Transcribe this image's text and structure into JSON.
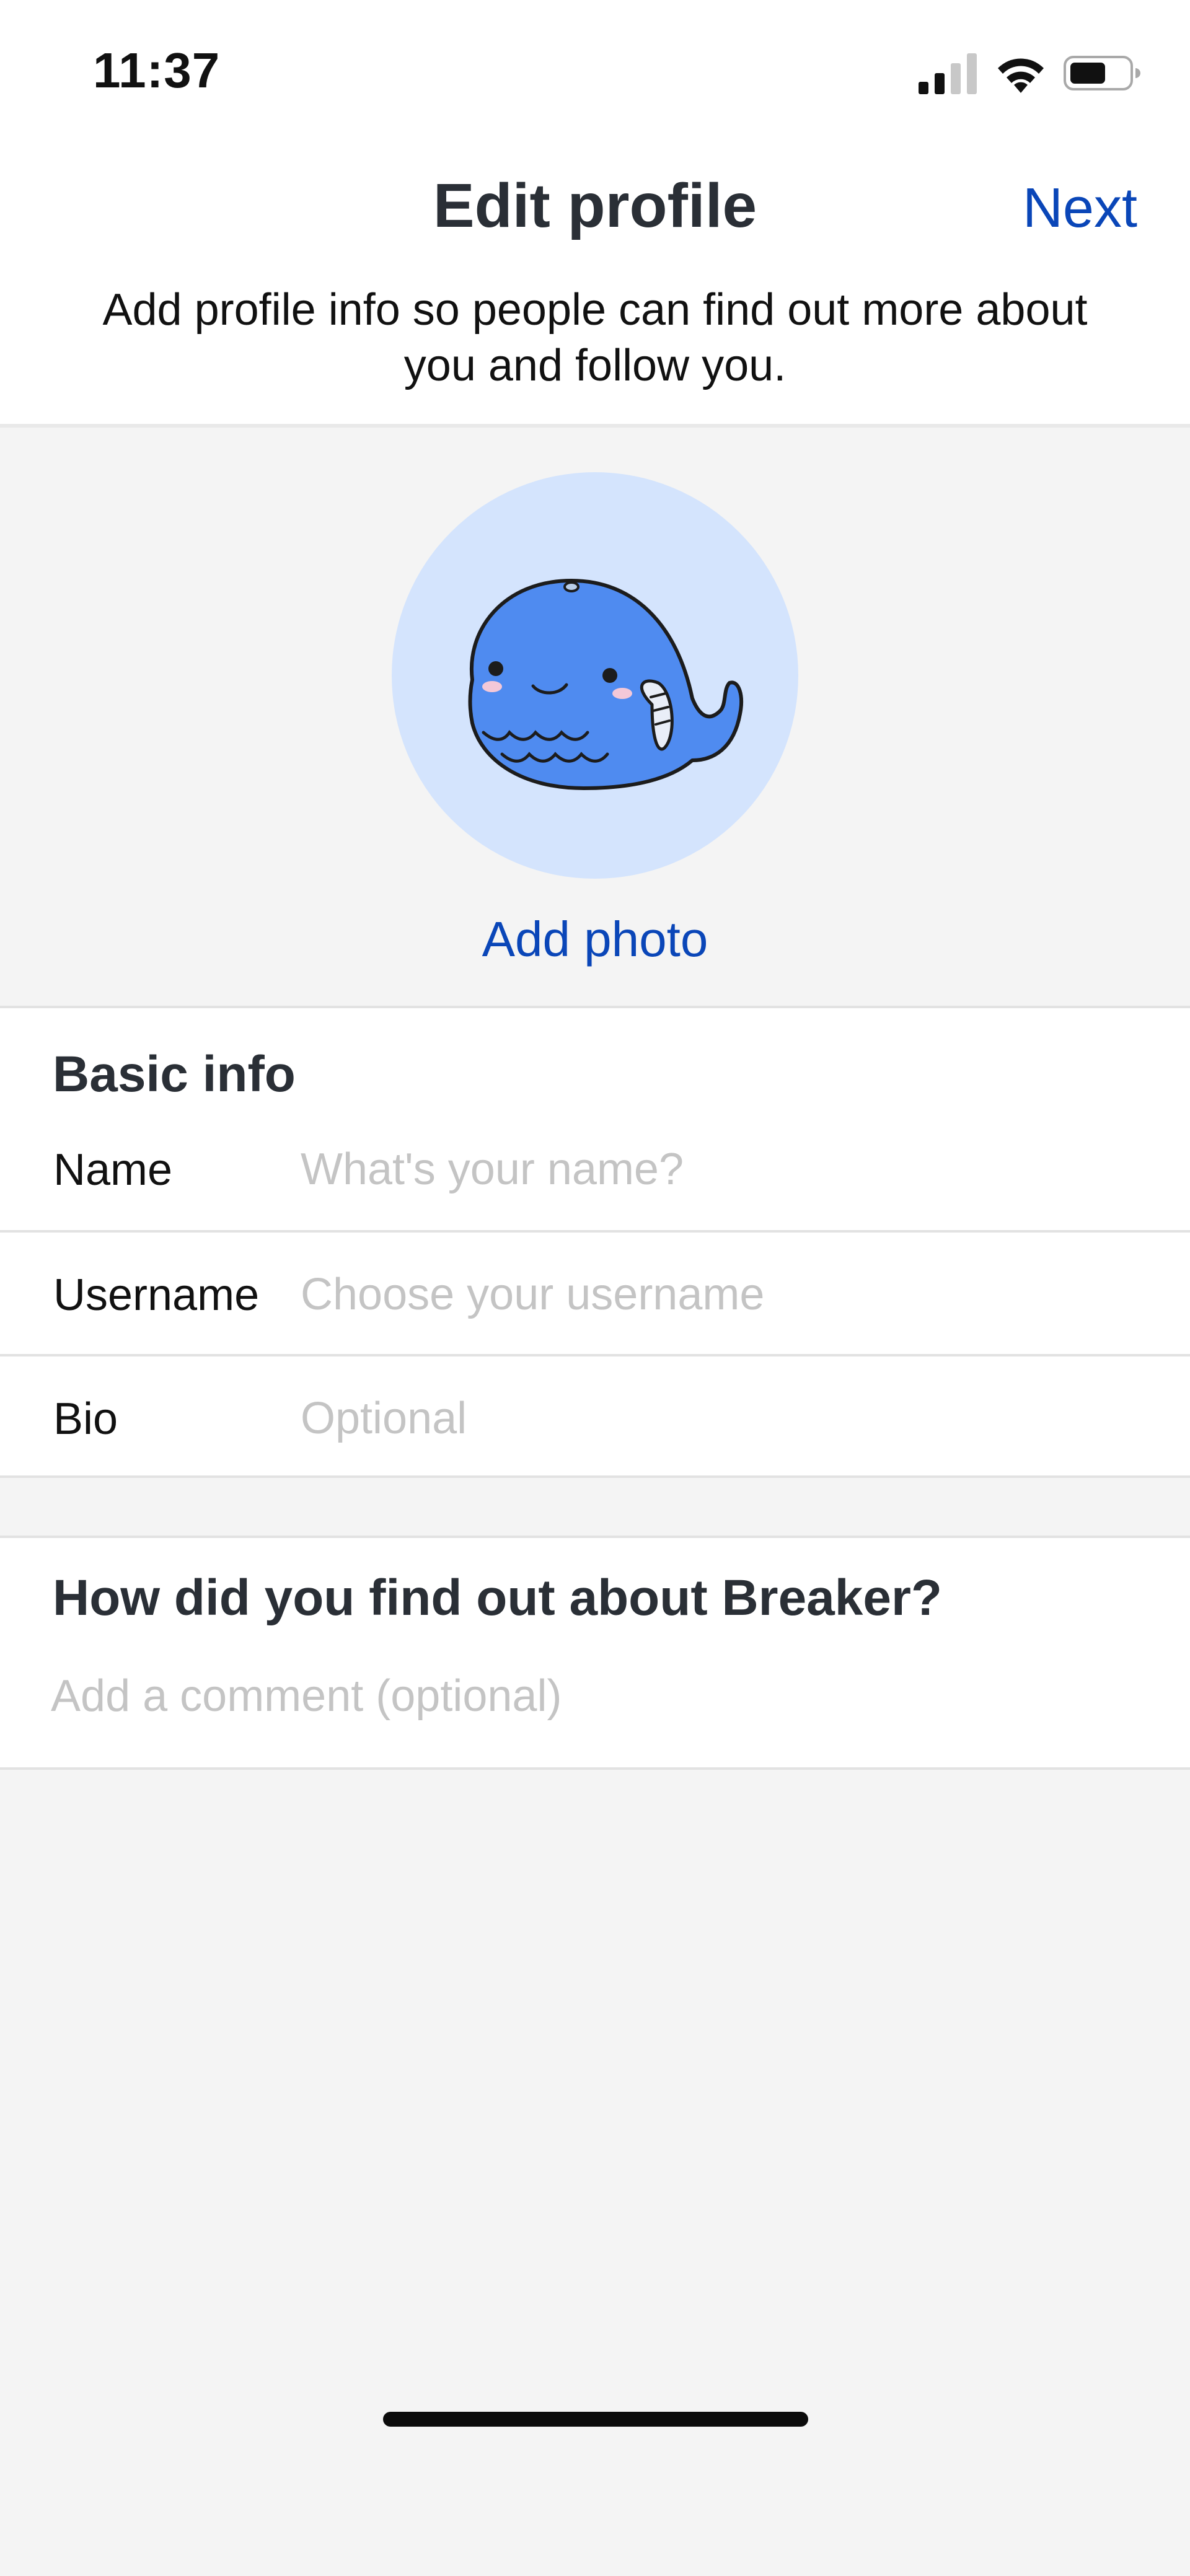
{
  "status_bar": {
    "time": "11:37",
    "icons": [
      "cellular-signal-icon",
      "wifi-icon",
      "battery-icon"
    ]
  },
  "header": {
    "title": "Edit profile",
    "next_label": "Next",
    "subtitle": "Add profile info so people can find out more about you and follow you."
  },
  "avatar": {
    "icon": "whale-avatar-icon",
    "add_photo_label": "Add photo"
  },
  "basic_info": {
    "heading": "Basic info",
    "fields": [
      {
        "label": "Name",
        "value": "",
        "placeholder": "What's your name?"
      },
      {
        "label": "Username",
        "value": "",
        "placeholder": "Choose your username"
      },
      {
        "label": "Bio",
        "value": "",
        "placeholder": "Optional"
      }
    ]
  },
  "referral": {
    "heading": "How did you find out about Breaker?",
    "value": "",
    "placeholder": "Add a comment (optional)"
  },
  "colors": {
    "accent": "#0a46b8",
    "avatar_background": "#d4e4fd",
    "whale": "#4f8bf0",
    "page_background": "#f4f4f4",
    "placeholder": "#c4c4c4"
  }
}
